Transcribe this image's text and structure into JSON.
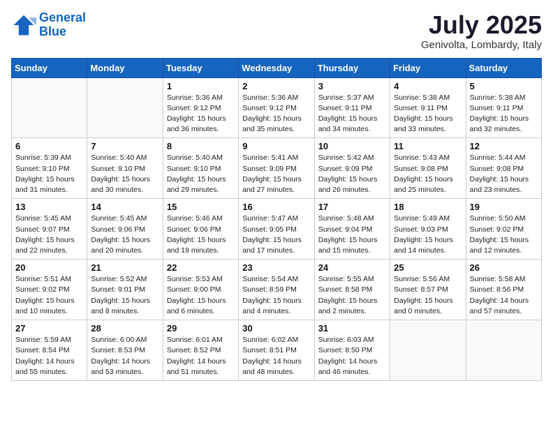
{
  "logo": {
    "line1": "General",
    "line2": "Blue"
  },
  "title": "July 2025",
  "subtitle": "Genivolta, Lombardy, Italy",
  "weekdays": [
    "Sunday",
    "Monday",
    "Tuesday",
    "Wednesday",
    "Thursday",
    "Friday",
    "Saturday"
  ],
  "weeks": [
    [
      {
        "day": "",
        "info": ""
      },
      {
        "day": "",
        "info": ""
      },
      {
        "day": "1",
        "info": "Sunrise: 5:36 AM\nSunset: 9:12 PM\nDaylight: 15 hours\nand 36 minutes."
      },
      {
        "day": "2",
        "info": "Sunrise: 5:36 AM\nSunset: 9:12 PM\nDaylight: 15 hours\nand 35 minutes."
      },
      {
        "day": "3",
        "info": "Sunrise: 5:37 AM\nSunset: 9:11 PM\nDaylight: 15 hours\nand 34 minutes."
      },
      {
        "day": "4",
        "info": "Sunrise: 5:38 AM\nSunset: 9:11 PM\nDaylight: 15 hours\nand 33 minutes."
      },
      {
        "day": "5",
        "info": "Sunrise: 5:38 AM\nSunset: 9:11 PM\nDaylight: 15 hours\nand 32 minutes."
      }
    ],
    [
      {
        "day": "6",
        "info": "Sunrise: 5:39 AM\nSunset: 9:10 PM\nDaylight: 15 hours\nand 31 minutes."
      },
      {
        "day": "7",
        "info": "Sunrise: 5:40 AM\nSunset: 9:10 PM\nDaylight: 15 hours\nand 30 minutes."
      },
      {
        "day": "8",
        "info": "Sunrise: 5:40 AM\nSunset: 9:10 PM\nDaylight: 15 hours\nand 29 minutes."
      },
      {
        "day": "9",
        "info": "Sunrise: 5:41 AM\nSunset: 9:09 PM\nDaylight: 15 hours\nand 27 minutes."
      },
      {
        "day": "10",
        "info": "Sunrise: 5:42 AM\nSunset: 9:09 PM\nDaylight: 15 hours\nand 26 minutes."
      },
      {
        "day": "11",
        "info": "Sunrise: 5:43 AM\nSunset: 9:08 PM\nDaylight: 15 hours\nand 25 minutes."
      },
      {
        "day": "12",
        "info": "Sunrise: 5:44 AM\nSunset: 9:08 PM\nDaylight: 15 hours\nand 23 minutes."
      }
    ],
    [
      {
        "day": "13",
        "info": "Sunrise: 5:45 AM\nSunset: 9:07 PM\nDaylight: 15 hours\nand 22 minutes."
      },
      {
        "day": "14",
        "info": "Sunrise: 5:45 AM\nSunset: 9:06 PM\nDaylight: 15 hours\nand 20 minutes."
      },
      {
        "day": "15",
        "info": "Sunrise: 5:46 AM\nSunset: 9:06 PM\nDaylight: 15 hours\nand 19 minutes."
      },
      {
        "day": "16",
        "info": "Sunrise: 5:47 AM\nSunset: 9:05 PM\nDaylight: 15 hours\nand 17 minutes."
      },
      {
        "day": "17",
        "info": "Sunrise: 5:48 AM\nSunset: 9:04 PM\nDaylight: 15 hours\nand 15 minutes."
      },
      {
        "day": "18",
        "info": "Sunrise: 5:49 AM\nSunset: 9:03 PM\nDaylight: 15 hours\nand 14 minutes."
      },
      {
        "day": "19",
        "info": "Sunrise: 5:50 AM\nSunset: 9:02 PM\nDaylight: 15 hours\nand 12 minutes."
      }
    ],
    [
      {
        "day": "20",
        "info": "Sunrise: 5:51 AM\nSunset: 9:02 PM\nDaylight: 15 hours\nand 10 minutes."
      },
      {
        "day": "21",
        "info": "Sunrise: 5:52 AM\nSunset: 9:01 PM\nDaylight: 15 hours\nand 8 minutes."
      },
      {
        "day": "22",
        "info": "Sunrise: 5:53 AM\nSunset: 9:00 PM\nDaylight: 15 hours\nand 6 minutes."
      },
      {
        "day": "23",
        "info": "Sunrise: 5:54 AM\nSunset: 8:59 PM\nDaylight: 15 hours\nand 4 minutes."
      },
      {
        "day": "24",
        "info": "Sunrise: 5:55 AM\nSunset: 8:58 PM\nDaylight: 15 hours\nand 2 minutes."
      },
      {
        "day": "25",
        "info": "Sunrise: 5:56 AM\nSunset: 8:57 PM\nDaylight: 15 hours\nand 0 minutes."
      },
      {
        "day": "26",
        "info": "Sunrise: 5:58 AM\nSunset: 8:56 PM\nDaylight: 14 hours\nand 57 minutes."
      }
    ],
    [
      {
        "day": "27",
        "info": "Sunrise: 5:59 AM\nSunset: 8:54 PM\nDaylight: 14 hours\nand 55 minutes."
      },
      {
        "day": "28",
        "info": "Sunrise: 6:00 AM\nSunset: 8:53 PM\nDaylight: 14 hours\nand 53 minutes."
      },
      {
        "day": "29",
        "info": "Sunrise: 6:01 AM\nSunset: 8:52 PM\nDaylight: 14 hours\nand 51 minutes."
      },
      {
        "day": "30",
        "info": "Sunrise: 6:02 AM\nSunset: 8:51 PM\nDaylight: 14 hours\nand 48 minutes."
      },
      {
        "day": "31",
        "info": "Sunrise: 6:03 AM\nSunset: 8:50 PM\nDaylight: 14 hours\nand 46 minutes."
      },
      {
        "day": "",
        "info": ""
      },
      {
        "day": "",
        "info": ""
      }
    ]
  ]
}
